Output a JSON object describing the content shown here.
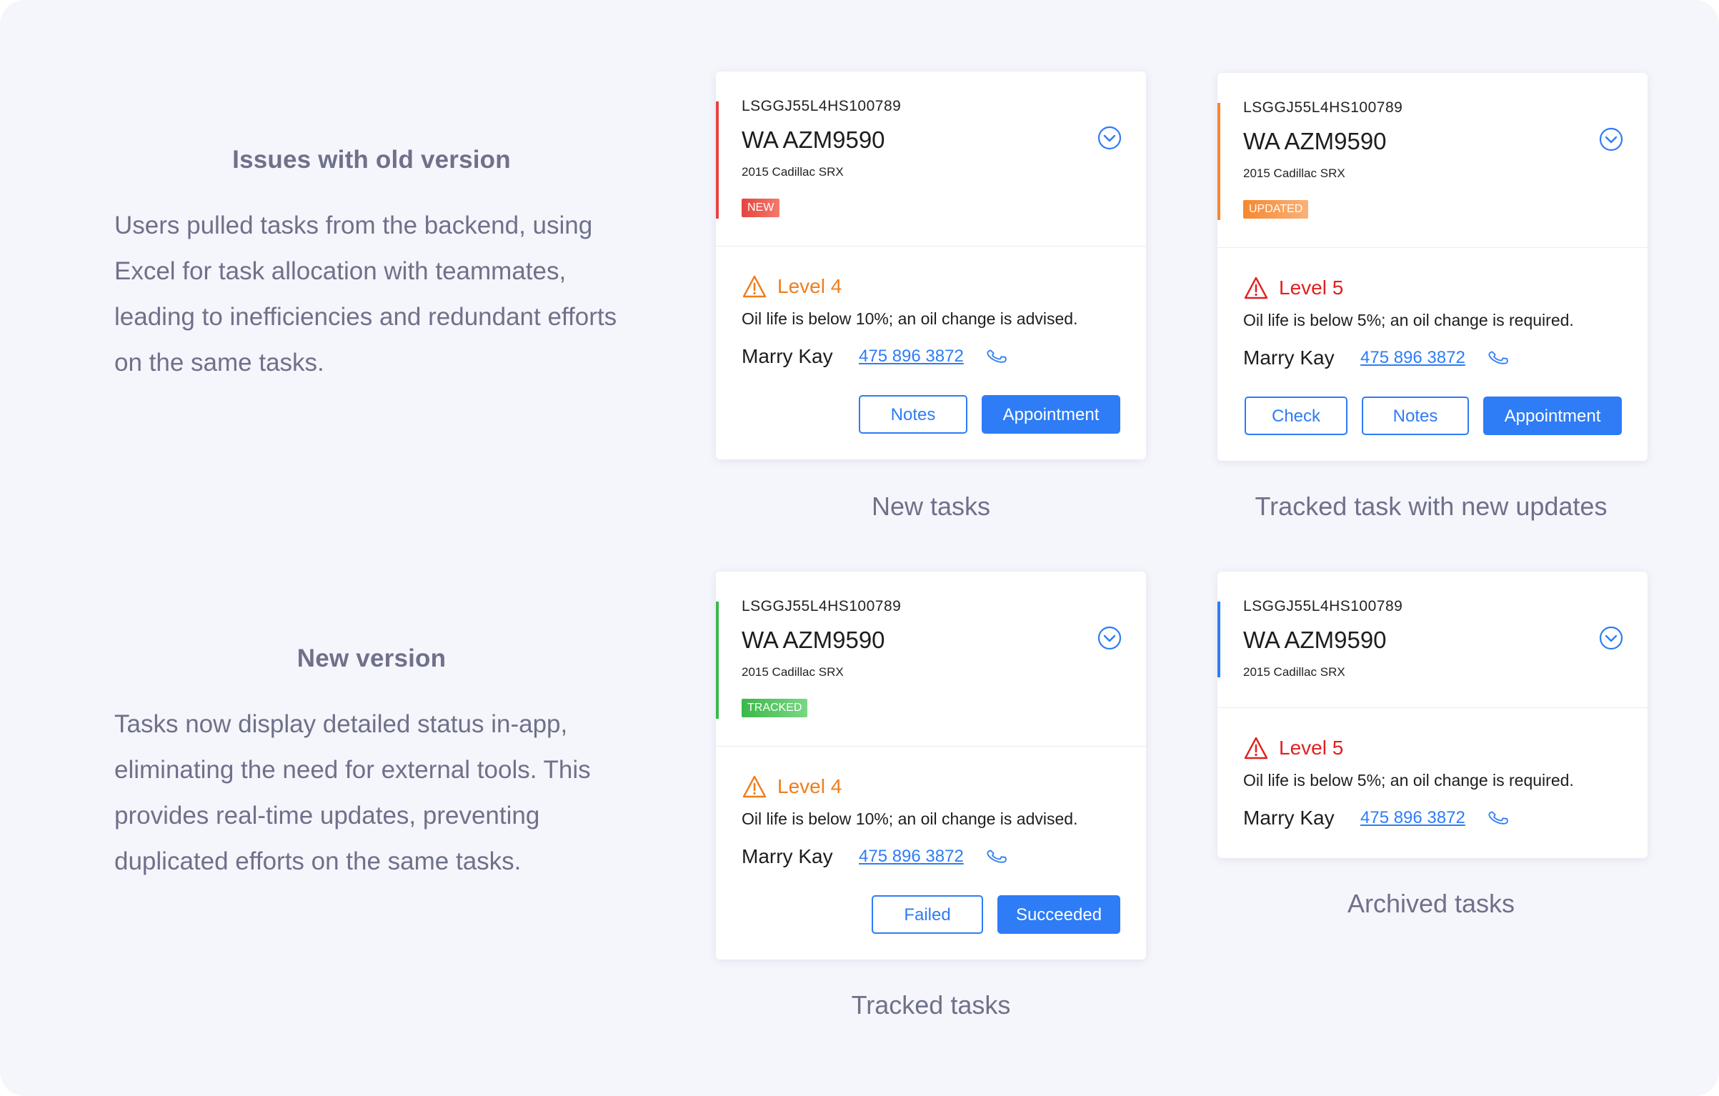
{
  "colors": {
    "background": "#f5f5fc",
    "accent_blue": "#2e7cf6",
    "new_red": "#e64340",
    "updated_orange": "#f6882f",
    "tracked_green": "#3bb84a",
    "archived_blue": "#2e7cf6",
    "level4_orange": "#f07d1a",
    "level5_red": "#e02020",
    "muted_text": "#6e7189"
  },
  "sections": [
    {
      "title": "Issues with old version",
      "text": "Users pulled tasks from the backend, using Excel for task allocation with teammates, leading to inefficiencies and redundant efforts on the same tasks."
    },
    {
      "title": "New version",
      "text": "Tasks now display detailed status in-app, eliminating the need for external tools. This provides real-time updates, preventing duplicated efforts on the same tasks."
    }
  ],
  "cards": [
    {
      "caption": "New tasks",
      "vin": "LSGGJ55L4HS100789",
      "plate": "WA AZM9590",
      "model": "2015 Cadillac SRX",
      "badge": "NEW",
      "level": "Level 4",
      "issue": "Oil life is below 10%; an oil change is advised.",
      "contact_name": "Marry Kay",
      "phone": "475 896 3872",
      "buttons": [
        "Notes",
        "Appointment"
      ],
      "expand_icon": "chevron-down-circle-icon",
      "warning_icon": "warning-triangle-icon",
      "phone_icon": "phone-icon"
    },
    {
      "caption": "Tracked task with new updates",
      "vin": "LSGGJ55L4HS100789",
      "plate": "WA AZM9590",
      "model": "2015 Cadillac SRX",
      "badge": "UPDATED",
      "level": "Level 5",
      "issue": "Oil life is below 5%; an oil change is required.",
      "contact_name": "Marry Kay",
      "phone": "475 896 3872",
      "buttons": [
        "Check",
        "Notes",
        "Appointment"
      ]
    },
    {
      "caption": "Tracked tasks",
      "vin": "LSGGJ55L4HS100789",
      "plate": "WA AZM9590",
      "model": "2015 Cadillac SRX",
      "badge": "TRACKED",
      "level": "Level 4",
      "issue": "Oil life is below 10%; an oil change is advised.",
      "contact_name": "Marry Kay",
      "phone": "475 896 3872",
      "buttons": [
        "Failed",
        "Succeeded"
      ]
    },
    {
      "caption": "Archived tasks",
      "vin": "LSGGJ55L4HS100789",
      "plate": "WA AZM9590",
      "model": "2015 Cadillac SRX",
      "level": "Level 5",
      "issue": "Oil life is below 5%; an oil change is required.",
      "contact_name": "Marry Kay",
      "phone": "475 896 3872"
    }
  ]
}
